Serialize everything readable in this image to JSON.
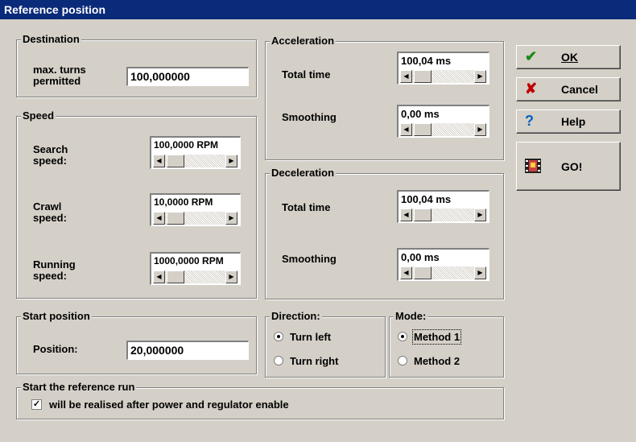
{
  "window": {
    "title": "Reference position"
  },
  "destination": {
    "title": "Destination",
    "max_turns_label_1": "max. turns",
    "max_turns_label_2": "permitted",
    "max_turns_value": "100,000000"
  },
  "speed": {
    "title": "Speed",
    "search_label_1": "Search",
    "search_label_2": "speed:",
    "search_value": "100,0000 RPM",
    "crawl_label_1": "Crawl",
    "crawl_label_2": "speed:",
    "crawl_value": "10,0000 RPM",
    "running_label_1": "Running",
    "running_label_2": "speed:",
    "running_value": "1000,0000 RPM"
  },
  "start_position": {
    "title": "Start position",
    "position_label": "Position:",
    "position_value": "20,000000"
  },
  "acceleration": {
    "title": "Acceleration",
    "total_time_label": "Total time",
    "total_time_value": "100,04 ms",
    "smoothing_label": "Smoothing",
    "smoothing_value": "0,00 ms"
  },
  "deceleration": {
    "title": "Deceleration",
    "total_time_label": "Total time",
    "total_time_value": "100,04 ms",
    "smoothing_label": "Smoothing",
    "smoothing_value": "0,00 ms"
  },
  "direction": {
    "title": "Direction:",
    "options": [
      "Turn left",
      "Turn right"
    ],
    "selected": "Turn left"
  },
  "mode": {
    "title": "Mode:",
    "options": [
      "Method 1",
      "Method 2"
    ],
    "selected": "Method 1"
  },
  "reference_run": {
    "title": "Start the reference run",
    "checkbox_label": "will be realised after power and regulator enable",
    "checked": true
  },
  "buttons": {
    "ok_label": "OK",
    "cancel_label": "Cancel",
    "help_label": "Help",
    "go_label": "GO!"
  },
  "icons": {
    "ok": "checkmark-icon",
    "cancel": "red-x-icon",
    "help": "question-mark-icon",
    "go": "film-run-icon",
    "scroll_left": "arrow-left-icon",
    "scroll_right": "arrow-right-icon"
  },
  "colors": {
    "title_bar": "#0a2a7a",
    "ok_icon": "#1a8a1a",
    "cancel_icon": "#c00000",
    "help_icon": "#0060c0"
  }
}
